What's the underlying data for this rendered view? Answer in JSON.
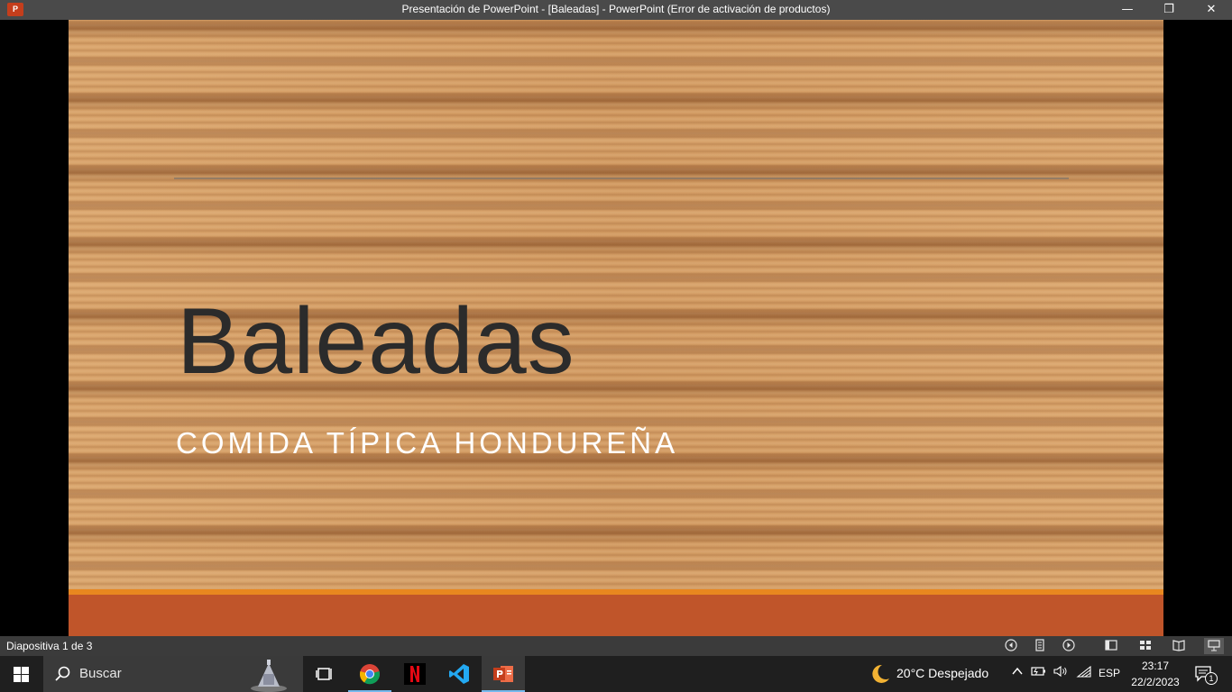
{
  "window": {
    "app_icon_label": "P",
    "title": "Presentación de PowerPoint - [Baleadas] - PowerPoint (Error de activación de productos)",
    "minimize_glyph": "—",
    "maximize_glyph": "❐",
    "close_glyph": "✕"
  },
  "slide": {
    "title": "Baleadas",
    "subtitle": "COMIDA TÍPICA HONDUREÑA",
    "colors": {
      "footer": "#c0552a",
      "accent_strip": "#e8871f",
      "title_text": "#2b2b2b",
      "subtitle_text": "#ffffff"
    }
  },
  "statusbar": {
    "slide_counter": "Diapositiva 1 de 3",
    "icons": [
      "previous-slide-icon",
      "slide-menu-icon",
      "next-slide-icon",
      "normal-view-icon",
      "slide-sorter-icon",
      "reading-view-icon",
      "slideshow-icon"
    ]
  },
  "taskbar": {
    "search_placeholder": "Buscar",
    "apps": [
      "task-view-icon",
      "chrome-icon",
      "netflix-icon",
      "vscode-icon",
      "powerpoint-icon"
    ],
    "weather": {
      "temperature": "20°C",
      "condition": "Despejado",
      "text": "20°C  Despejado"
    },
    "language": "ESP",
    "time": "23:17",
    "date": "22/2/2023",
    "notification_count": "1"
  }
}
